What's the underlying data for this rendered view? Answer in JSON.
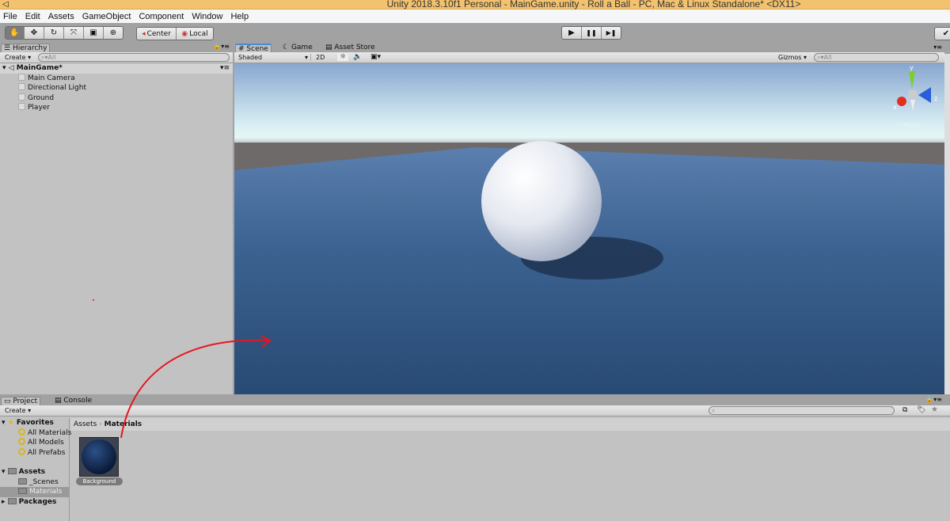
{
  "window": {
    "title": "Unity 2018.3.10f1 Personal - MainGame.unity - Roll a Ball - PC, Mac & Linux Standalone* <DX11>"
  },
  "menu": [
    "File",
    "Edit",
    "Assets",
    "GameObject",
    "Component",
    "Window",
    "Help"
  ],
  "toolbar": {
    "tools": [
      "hand-tool",
      "move-tool",
      "rotate-tool",
      "scale-tool",
      "rect-tool",
      "transform-tool"
    ],
    "pivot": "Center",
    "space": "Local",
    "play": "▶",
    "pause": "❚❚",
    "step": "▶❚"
  },
  "hierarchy": {
    "tab": "Hierarchy",
    "create": "Create ▾",
    "search_placeholder": "All",
    "scene": "MainGame*",
    "items": [
      "Main Camera",
      "Directional Light",
      "Ground",
      "Player"
    ]
  },
  "scene": {
    "tabs": [
      "Scene",
      "Game",
      "Asset Store"
    ],
    "draw_mode": "Shaded",
    "mode_2d": "2D",
    "gizmos": "Gizmos ▾",
    "search_placeholder": "All",
    "projection": "< Persp",
    "axes": {
      "y": "y",
      "x": "x",
      "z": "z"
    }
  },
  "project": {
    "tabs": [
      "Project",
      "Console"
    ],
    "create": "Create ▾",
    "favorites": {
      "label": "Favorites",
      "items": [
        "All Materials",
        "All Models",
        "All Prefabs"
      ]
    },
    "assets": {
      "label": "Assets",
      "items": [
        "_Scenes",
        "Materials"
      ]
    },
    "packages": "Packages",
    "breadcrumb": [
      "Assets",
      "Materials"
    ],
    "files": [
      {
        "name": "Background",
        "color": "#0f2a55"
      }
    ]
  },
  "colors": {
    "title_bar": "#f3c26e",
    "annotation_arrow": "#e8141e",
    "sky_top": "#8aa8d0",
    "ground": "#3b6290"
  }
}
